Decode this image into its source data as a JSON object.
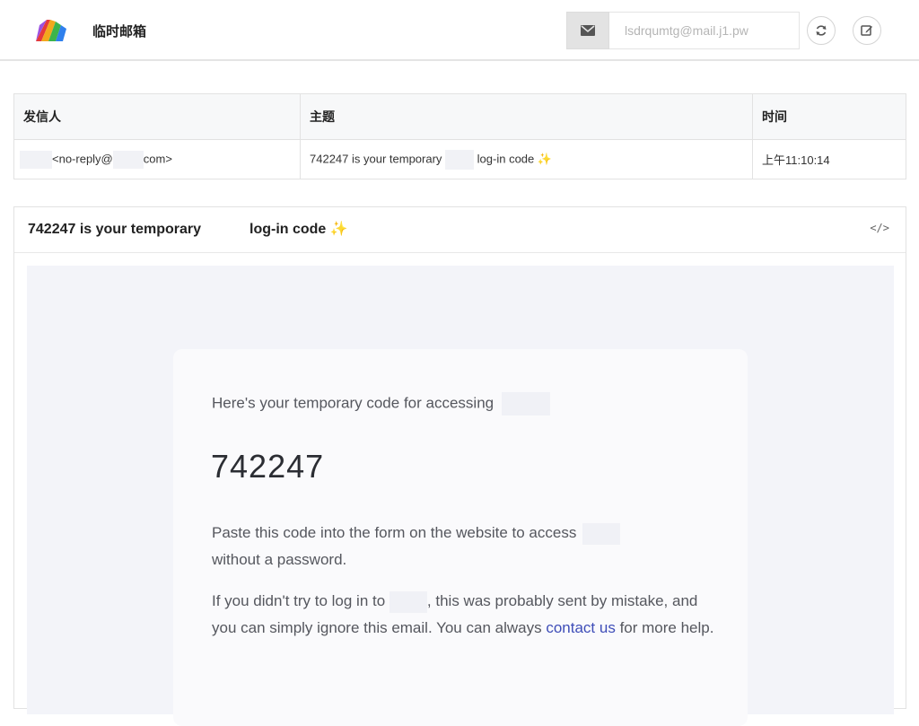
{
  "header": {
    "app_title": "临时邮箱",
    "mail_icon": "envelope-icon",
    "address": "lsdrqumtg@mail.j1.pw",
    "refresh_icon": "refresh-icon",
    "compose_icon": "compose-icon"
  },
  "inbox": {
    "columns": [
      "发信人",
      "主题",
      "时间"
    ],
    "rows": [
      {
        "sender_prefix": "<no-reply@",
        "sender_suffix": "com>",
        "subject_before": "742247 is your temporary",
        "subject_after": "log-in code ✨",
        "time": "上午11:10:14"
      }
    ]
  },
  "message": {
    "title_before": "742247 is your temporary",
    "title_after": "log-in code ✨",
    "source_icon": "code-view-icon",
    "intro": "Here's your temporary code for accessing",
    "code": "742247",
    "p1_before": "Paste this code into the form on the website to access",
    "p1_after": "without a password.",
    "p2_before": "If you didn't try to log in to",
    "p2_middle": ", this was probably sent by mistake, and you can simply ignore this email. You can always",
    "p2_link": "contact us",
    "p2_after": "for more help."
  },
  "colors": {
    "accent_link": "#3e4db8",
    "body_bg": "#f3f4f9"
  }
}
